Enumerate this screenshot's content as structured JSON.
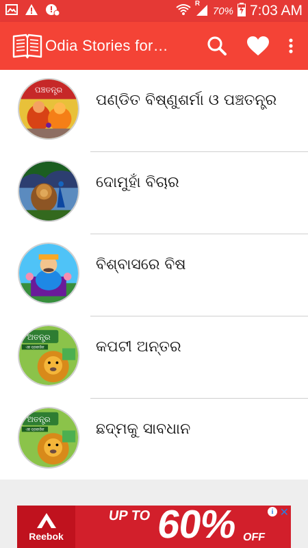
{
  "status_bar": {
    "battery_percent": "70%",
    "time": "7:03 AM",
    "signal_indicator": "R"
  },
  "app_bar": {
    "title": "Odia Stories for…",
    "icons": [
      "book-icon",
      "search-icon",
      "heart-icon",
      "more-vert-icon"
    ]
  },
  "stories": [
    {
      "title": "ପଣ୍ଡିତ ବିଷ୍ଣୁଶର୍ମା ଓ ପଞ୍ଚତନ୍ତ୍ର",
      "thumb_label": "ପଞ୍ଚତନ୍ତ୍ର"
    },
    {
      "title": "ଦୋମୁହାଁ ବିଚାର"
    },
    {
      "title": "ବିଶ୍ବାସରେ ବିଷ"
    },
    {
      "title": "କପଟୀ ଅନ୍ତର",
      "thumb_label": "ଅତନ୍ତ୍ର",
      "thumb_sublabel": "ଏକ ପ୍ରକାରିକ"
    },
    {
      "title": "ଛଦ୍ମକୁ ସାବଧାନ",
      "thumb_label": "ଅତନ୍ତ୍ର",
      "thumb_sublabel": "ଏକ ପ୍ରକାରିକ"
    }
  ],
  "ad": {
    "brand": "Reebok",
    "up_to": "UP TO",
    "percent": "60%",
    "off": "OFF",
    "info_glyph": "i",
    "close_glyph": "✕"
  },
  "colors": {
    "primary": "#f44336",
    "status_bar": "#e53935",
    "ad_red": "#d21f2b"
  }
}
